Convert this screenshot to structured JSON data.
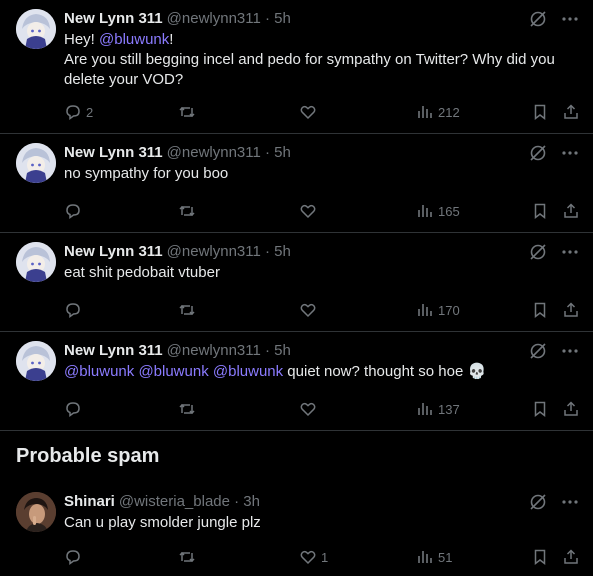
{
  "tweets": [
    {
      "name": "New Lynn 311",
      "handle": "@newlynn311 · 5h",
      "text_parts": [
        "Hey! ",
        "@bluwunk",
        "!",
        "Are you still begging incel and pedo for sympathy on Twitter? Why did you delete your VOD?"
      ],
      "replies": "2",
      "retweets": "",
      "likes": "",
      "views": "212"
    },
    {
      "name": "New Lynn 311",
      "handle": "@newlynn311 · 5h",
      "text": "no sympathy for you boo",
      "replies": "",
      "retweets": "",
      "likes": "",
      "views": "165"
    },
    {
      "name": "New Lynn 311",
      "handle": "@newlynn311 · 5h",
      "text": "eat shit pedobait vtuber",
      "replies": "",
      "retweets": "",
      "likes": "",
      "views": "170"
    },
    {
      "name": "New Lynn 311",
      "handle": "@newlynn311 · 5h",
      "mentions": [
        "@bluwunk",
        "@bluwunk",
        "@bluwunk"
      ],
      "text_tail": " quiet now? thought so hoe ",
      "emoji": "💀",
      "replies": "",
      "retweets": "",
      "likes": "",
      "views": "137"
    }
  ],
  "section": {
    "title": "Probable spam"
  },
  "spam_tweet": {
    "name": "Shinari",
    "handle": "@wisteria_blade · 3h",
    "text": "Can u play smolder jungle plz",
    "replies": "",
    "retweets": "",
    "likes": "1",
    "views": "51"
  },
  "colors": {
    "background": "#000000",
    "text": "#e7e9ea",
    "muted": "#71767b",
    "mention": "#8b7bff",
    "divider": "#2f3336"
  },
  "icons": [
    "grok-icon",
    "more-icon",
    "reply-icon",
    "retweet-icon",
    "like-icon",
    "views-icon",
    "bookmark-icon",
    "share-icon"
  ]
}
